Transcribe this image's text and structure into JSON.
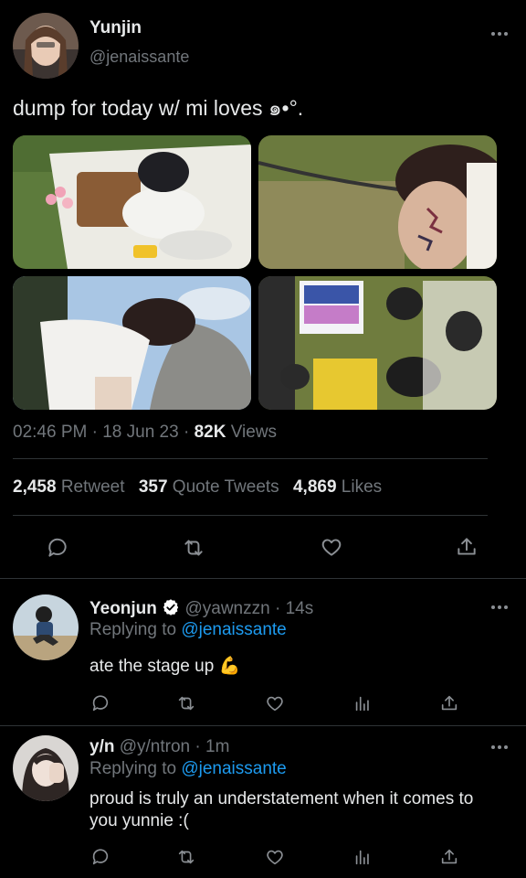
{
  "main_tweet": {
    "author_name": "Yunjin",
    "author_handle": "@jenaissante",
    "text": "dump for today w/ mi loves ๑•°.",
    "time": "02:46 PM",
    "sep1": "·",
    "date": "18 Jun 23",
    "sep2": "·",
    "views_count": "82K",
    "views_label": "Views",
    "stats": {
      "retweets_count": "2,458",
      "retweets_label": "Retweet",
      "quotes_count": "357",
      "quotes_label": "Quote Tweets",
      "likes_count": "4,869",
      "likes_label": "Likes"
    }
  },
  "replies": [
    {
      "author_name": "Yeonjun",
      "author_handle": "@yawnzzn",
      "dot": "·",
      "time": "14s",
      "replying_prefix": "Replying to",
      "replying_to": "@jenaissante",
      "text": "ate the stage up 💪"
    },
    {
      "author_name": "y/n",
      "author_handle": "@y/ntron",
      "dot": "·",
      "time": "1m",
      "replying_prefix": "Replying to",
      "replying_to": "@jenaissante",
      "text": "proud is truly an understatement when it comes to you yunnie :("
    }
  ],
  "colors": {
    "background": "#000000",
    "text": "#e7e9ea",
    "muted": "#71767b",
    "link": "#1d9bf0",
    "divider": "#2f3336"
  }
}
